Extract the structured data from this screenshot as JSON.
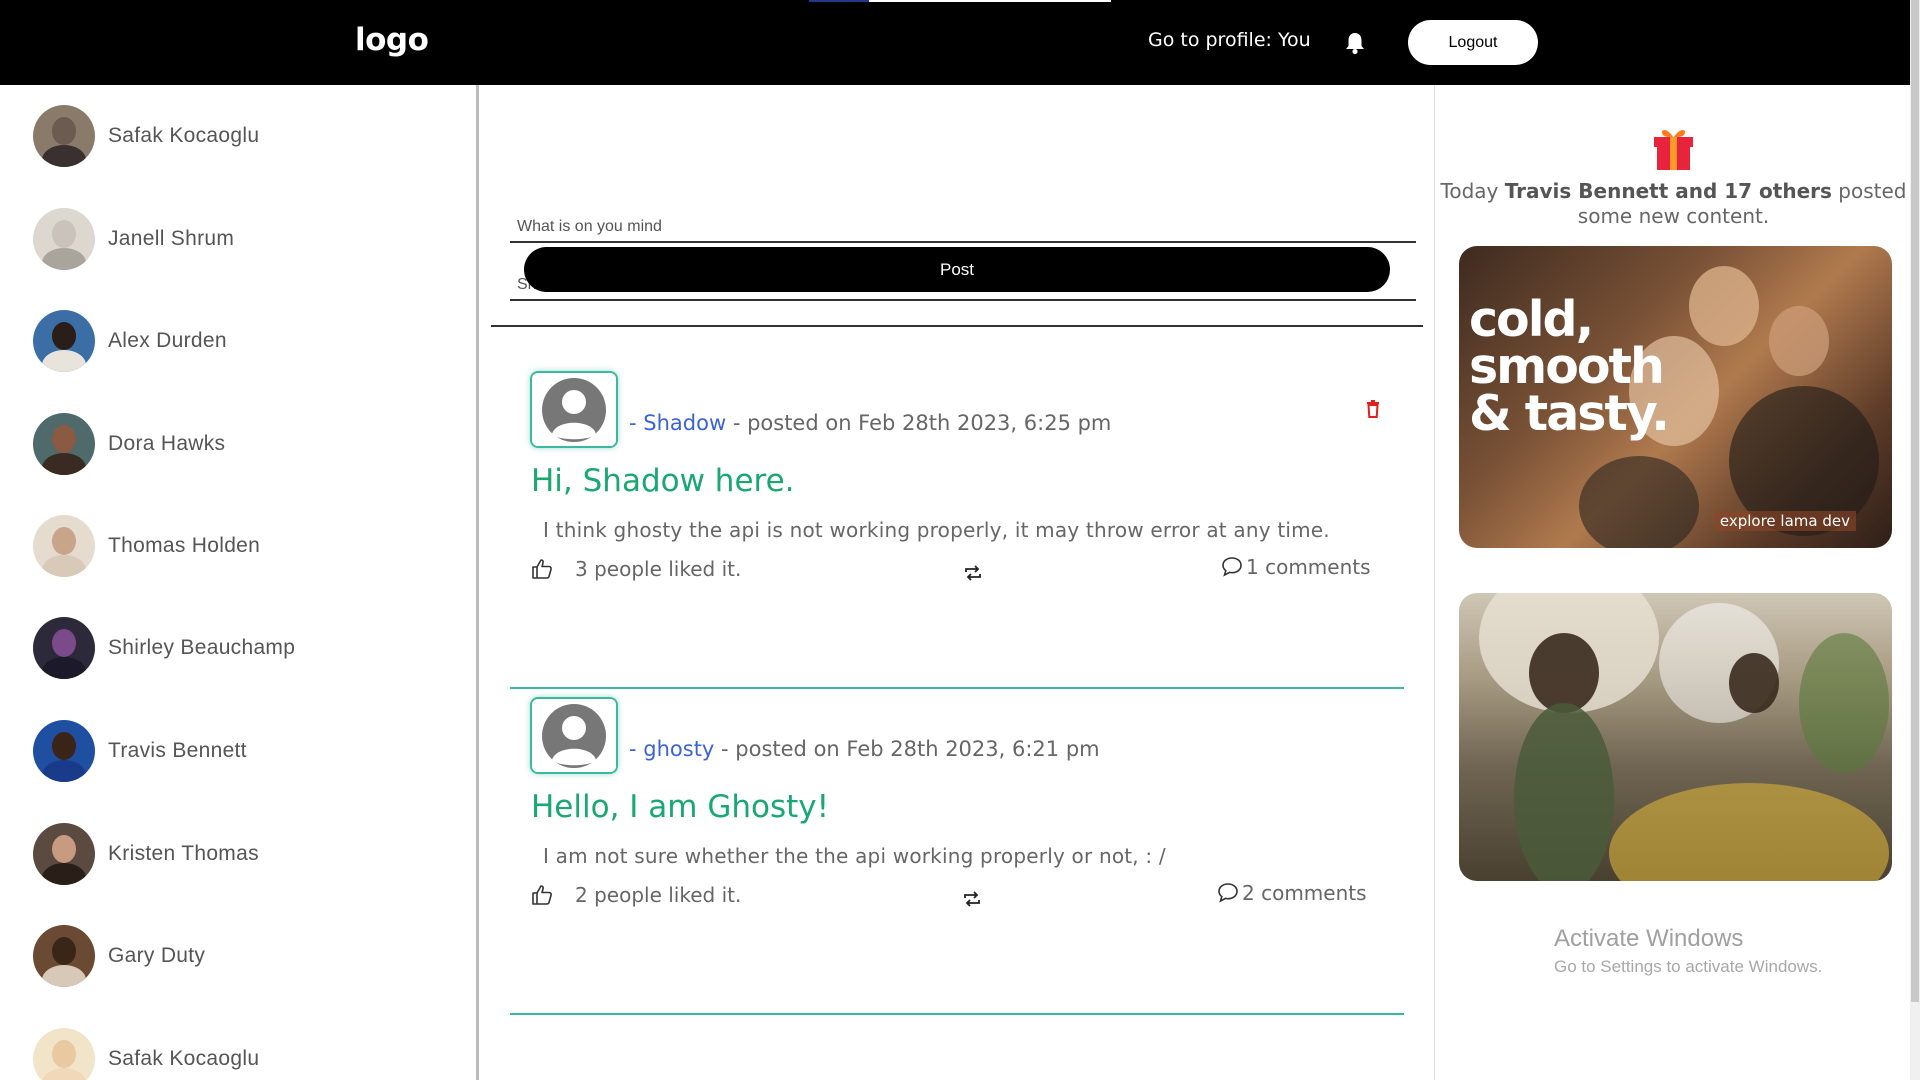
{
  "header": {
    "logo": "logo",
    "profile_link": "Go to profile: You",
    "logout_label": "Logout",
    "loading_progress": 0.2
  },
  "sidebar": {
    "users": [
      {
        "name": "Safak Kocaoglu",
        "tone": "#6b5b50"
      },
      {
        "name": "Janell Shrum",
        "tone": "#c9c3bb"
      },
      {
        "name": "Alex Durden",
        "tone": "#3a6ea5"
      },
      {
        "name": "Dora Hawks",
        "tone": "#6a4a3a"
      },
      {
        "name": "Thomas Holden",
        "tone": "#d8c9b8"
      },
      {
        "name": "Shirley Beauchamp",
        "tone": "#2c2a3a"
      },
      {
        "name": "Travis Bennett",
        "tone": "#1f4fa0"
      },
      {
        "name": "Kristen Thomas",
        "tone": "#4a3a32"
      },
      {
        "name": "Gary Duty",
        "tone": "#5a4232"
      },
      {
        "name": "Safak Kocaoglu",
        "tone": "#e8c9a0"
      }
    ]
  },
  "compose": {
    "text_placeholder": "What is on you mind",
    "memories_placeholder": "Share some memories",
    "post_label": "Post"
  },
  "posts": [
    {
      "author": "Shadow",
      "prefix": "- ",
      "meta": " - posted on Feb 28th 2023, 6:25 pm",
      "title": "Hi, Shadow here.",
      "body": "I think ghosty the api is not working properly, it may throw error at any time.",
      "likes": "3 people liked it.",
      "comments": "1 comments",
      "deletable": true
    },
    {
      "author": "ghosty",
      "prefix": "- ",
      "meta": " - posted on Feb 28th 2023, 6:21 pm",
      "title": "Hello, I am Ghosty!",
      "body": "I am not sure whether the the api working properly or not, : /",
      "likes": "2 people liked it.",
      "comments": "2 comments",
      "deletable": false
    }
  ],
  "rightbar": {
    "birthday_prefix": "Today ",
    "birthday_names": "Travis Bennett and 17 others",
    "birthday_suffix": " posted some new content.",
    "ad1_headline": "cold, smooth & tasty.",
    "ad1_tag": "explore lama dev"
  },
  "watermark": {
    "title": "Activate Windows",
    "subtitle": "Go to Settings to activate Windows."
  },
  "colors": {
    "accent_green": "#1aa872",
    "teal_border": "#3cb8a0",
    "link_blue": "#3b63d6",
    "delete_red": "#e0201a"
  }
}
